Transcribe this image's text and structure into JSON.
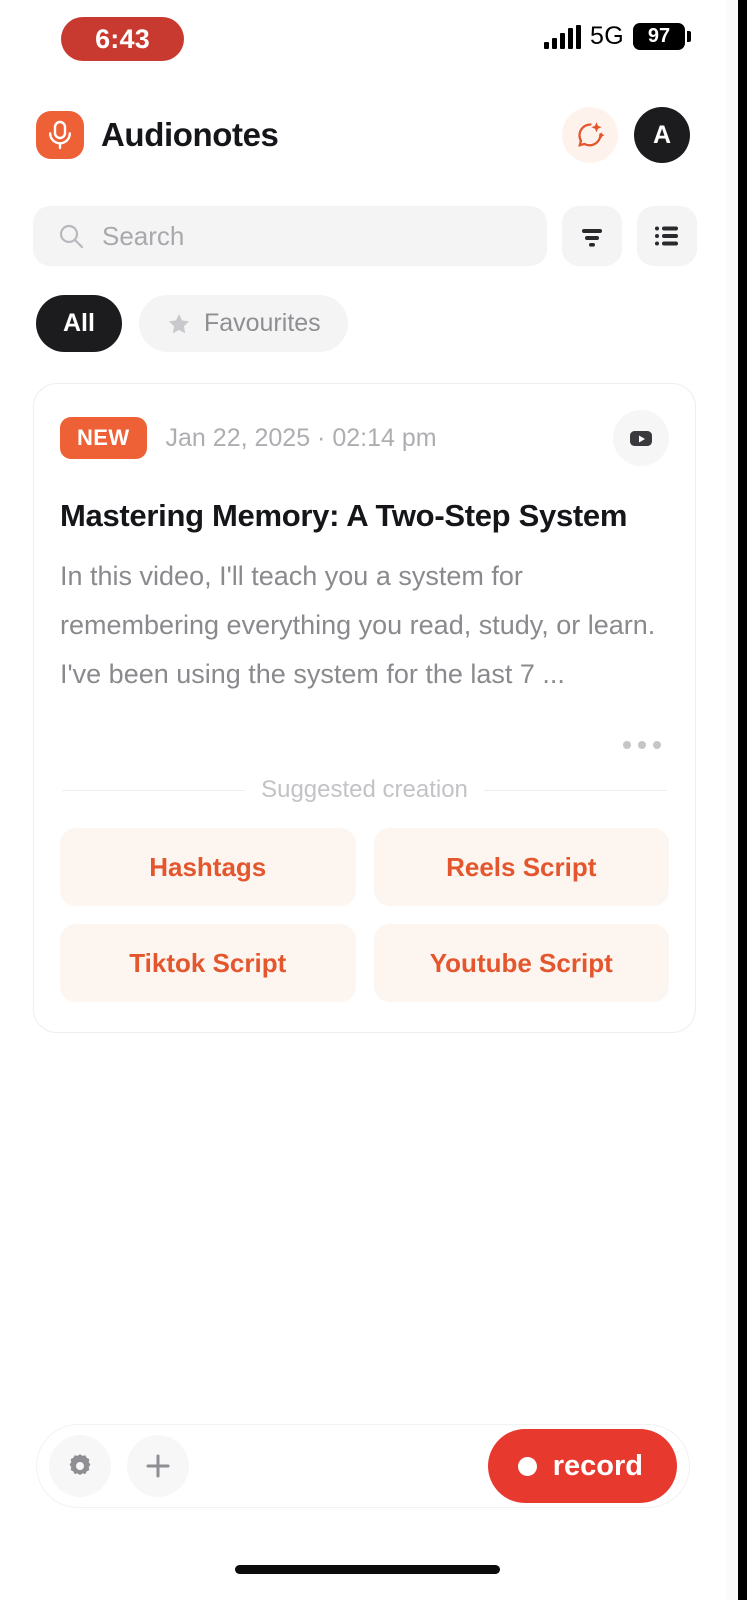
{
  "status_bar": {
    "time": "6:43",
    "network": "5G",
    "battery": "97",
    "signal_icon": "signal-bars-icon",
    "battery_icon": "battery-icon"
  },
  "header": {
    "app_name": "Audionotes",
    "logo_icon": "microphone-icon",
    "ai_icon": "ai-sparkle-chat-icon",
    "avatar_initial": "A"
  },
  "search": {
    "placeholder": "Search",
    "value": "",
    "search_icon": "search-icon",
    "filter_icon": "filter-icon",
    "list_view_icon": "list-view-icon"
  },
  "filters": [
    {
      "label": "All",
      "active": true,
      "icon": ""
    },
    {
      "label": "Favourites",
      "active": false,
      "icon": "star-icon"
    }
  ],
  "note": {
    "badge": "NEW",
    "date": "Jan 22, 2025 · 02:14 pm",
    "source_icon": "youtube-play-icon",
    "title": "Mastering Memory: A Two-Step System",
    "body": "In this video, I'll teach you a system for remembering everything you read, study, or learn. I've been using the system for the last 7 ...",
    "more_icon": "more-horizontal-icon",
    "suggested_label": "Suggested creation",
    "suggestions": [
      "Hashtags",
      "Reels Script",
      "Tiktok Script",
      "Youtube Script"
    ]
  },
  "bottom_bar": {
    "settings_icon": "gear-icon",
    "add_icon": "plus-icon",
    "record_label": "record",
    "record_dot_icon": "record-dot-icon"
  },
  "colors": {
    "brand_orange": "#ee6136",
    "suggestion_text": "#e4572e",
    "suggestion_bg": "#fdf5f0",
    "record_red": "#e8392f",
    "recording_pill": "#c8392f",
    "dark": "#1c1c1e",
    "muted_text": "#8a8a8e"
  }
}
